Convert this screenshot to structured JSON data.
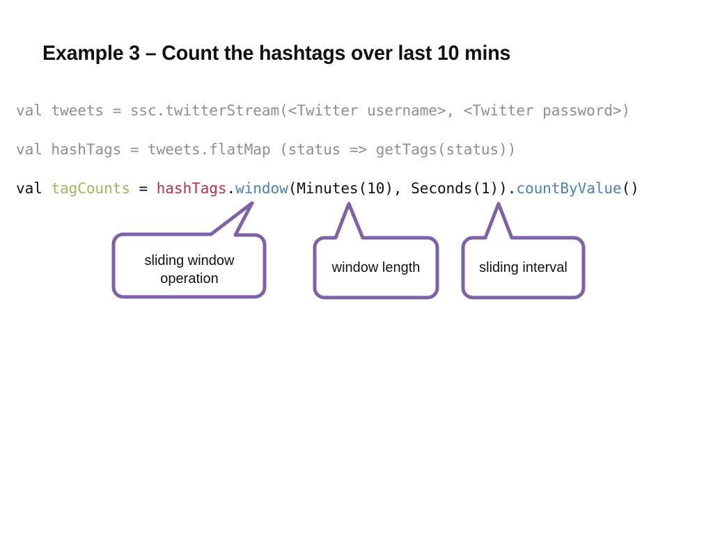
{
  "slide": {
    "title": "Example 3 – Count the hashtags over last 10 mins",
    "background_color": "#ffffff"
  },
  "colors": {
    "code_dim": "#8f8f8f",
    "code_plain": "#111111",
    "token_green": "#9cb95c",
    "token_red": "#bf2f46",
    "token_blue": "#4a80bd",
    "callout_stroke": "#7e62a8",
    "callout_fill": "#ffffff",
    "title_color": "#111111"
  },
  "code": {
    "line1": "val tweets = ssc.twitterStream(<Twitter username>, <Twitter password>)",
    "line2": "val hashTags = tweets.flatMap (status => getTags(status))",
    "line3": {
      "t1": "val ",
      "t2": "tagCounts",
      "t3": " = ",
      "t4": "hashTags",
      "t5": ".",
      "t6": "window",
      "t7": "(Minutes(10), Seconds(1)).",
      "t8": "countByValue",
      "t9": "()"
    }
  },
  "callouts": [
    {
      "id": "sliding-window-operation",
      "label": "sliding window\noperation",
      "points_to": "window"
    },
    {
      "id": "window-length",
      "label": "window length",
      "points_to": "Minutes(10)"
    },
    {
      "id": "sliding-interval",
      "label": "sliding interval",
      "points_to": "Seconds(1)"
    }
  ]
}
